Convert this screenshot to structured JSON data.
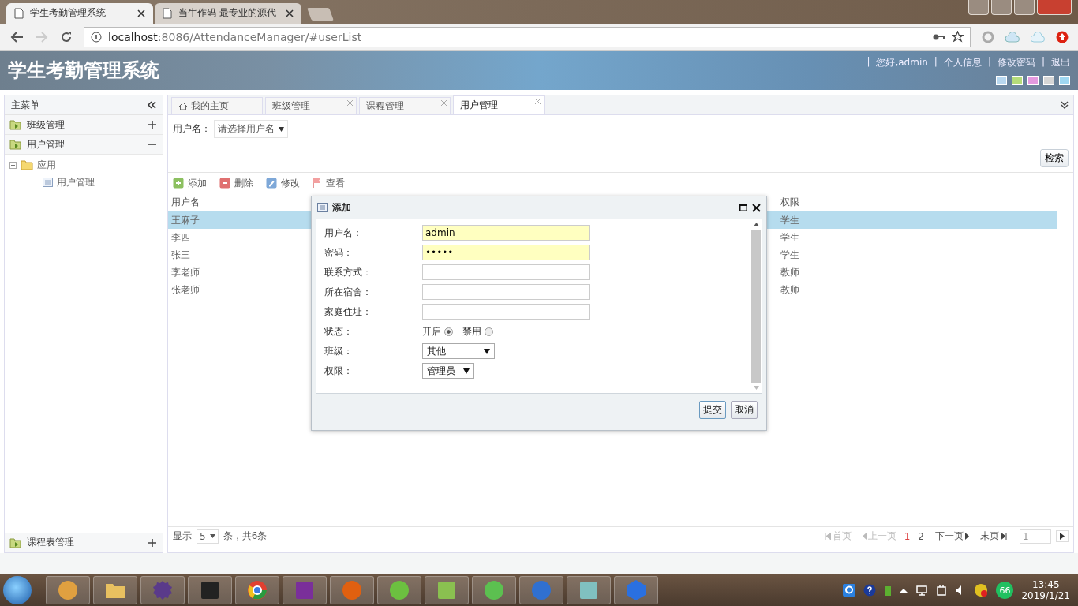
{
  "browser": {
    "tabs": [
      {
        "title": "学生考勤管理系统",
        "selected": true
      },
      {
        "title": "当牛作码-最专业的源代",
        "selected": false
      }
    ],
    "url_host": "localhost",
    "url_path": ":8086/AttendanceManager/#userList"
  },
  "header": {
    "title": "学生考勤管理系统",
    "links": [
      {
        "separator": "|",
        "label": "您好,admin"
      },
      {
        "separator": "|",
        "label": "个人信息"
      },
      {
        "separator": "|",
        "label": "修改密码"
      },
      {
        "separator": "|",
        "label": "退出"
      }
    ],
    "themes": [
      {
        "color": "#b8d8f0"
      },
      {
        "color": "#b5dc7a"
      },
      {
        "color": "#e49ae0"
      },
      {
        "color": "#d6d6d6"
      },
      {
        "color": "#9fd8f2"
      }
    ]
  },
  "sidebar": {
    "title": "主菜单",
    "groups": [
      {
        "label": "班级管理",
        "expanded": false
      },
      {
        "label": "用户管理",
        "expanded": true,
        "children": [
          {
            "label": "应用",
            "expanded": true,
            "children": [
              {
                "label": "用户管理"
              }
            ]
          }
        ]
      }
    ],
    "bottom_group": {
      "label": "课程表管理",
      "expanded": false
    }
  },
  "tabs": [
    {
      "label": "我的主页",
      "selected": false,
      "closable": false
    },
    {
      "label": "班级管理",
      "selected": false,
      "closable": true
    },
    {
      "label": "课程管理",
      "selected": false,
      "closable": true
    },
    {
      "label": "用户管理",
      "selected": true,
      "closable": true
    }
  ],
  "filter": {
    "label": "用户名：",
    "placeholder": "请选择用户名",
    "button": "检索"
  },
  "toolbar": [
    {
      "label": "添加",
      "kind": "add"
    },
    {
      "label": "删除",
      "kind": "delete"
    },
    {
      "label": "修改",
      "kind": "edit"
    },
    {
      "label": "查看",
      "kind": "view"
    }
  ],
  "table": {
    "columns": [
      "用户名",
      "权限"
    ],
    "rows": [
      {
        "cells": [
          "王麻子",
          "学生"
        ],
        "selected": true
      },
      {
        "cells": [
          "李四",
          "学生"
        ],
        "selected": false
      },
      {
        "cells": [
          "张三",
          "学生"
        ],
        "selected": false
      },
      {
        "cells": [
          "李老师",
          "教师"
        ],
        "selected": false
      },
      {
        "cells": [
          "张老师",
          "教师"
        ],
        "selected": false
      }
    ]
  },
  "pager": {
    "show": "显示",
    "page_size": "5",
    "summary": "条，共6条",
    "first": "首页",
    "prev": "上一页",
    "pages": [
      {
        "label": "1",
        "selected": true
      },
      {
        "label": "2",
        "selected": false
      }
    ],
    "next": "下一页",
    "last": "末页",
    "page_input": "1"
  },
  "dialog": {
    "title": "添加",
    "fields": [
      {
        "label": "用户名：",
        "kind": "text",
        "value": "admin",
        "highlighted": true
      },
      {
        "label": "密码：",
        "kind": "text",
        "value": "•••••",
        "highlighted": true
      },
      {
        "label": "联系方式：",
        "kind": "text",
        "highlighted": false
      },
      {
        "label": "所在宿舍：",
        "kind": "text",
        "highlighted": false
      },
      {
        "label": "家庭住址：",
        "kind": "text",
        "highlighted": false
      },
      {
        "label": "状态：",
        "kind": "radio",
        "options": [
          {
            "label": "开启",
            "selected": true
          },
          {
            "label": "禁用",
            "selected": false
          }
        ]
      },
      {
        "label": "班级：",
        "kind": "select",
        "value": "其他"
      },
      {
        "label": "权限：",
        "kind": "select",
        "value": "管理员"
      }
    ],
    "buttons": [
      "提交",
      "取消"
    ]
  },
  "taskbar": {
    "badge": "66",
    "time": "13:45",
    "date": "2019/1/21"
  }
}
